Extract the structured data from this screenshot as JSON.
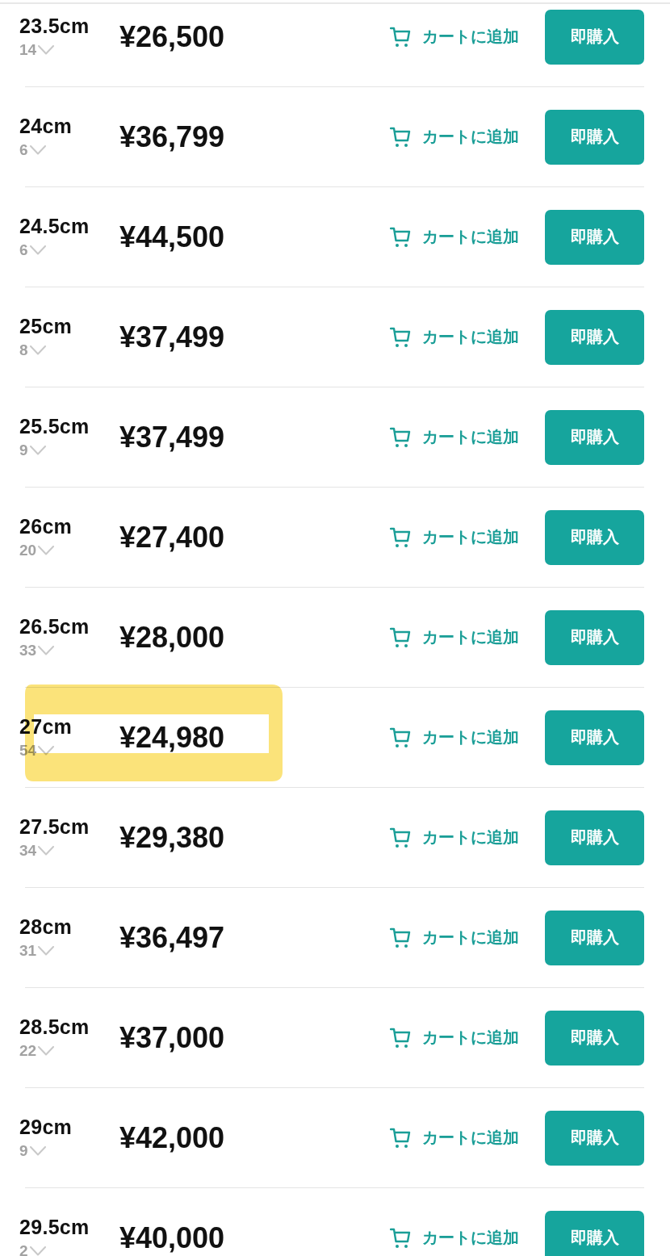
{
  "rows": [
    {
      "size": "23.5cm",
      "count": "14",
      "price": "¥26,500",
      "cart_label": "カートに追加",
      "buy_label": "即購入",
      "highlighted": false
    },
    {
      "size": "24cm",
      "count": "6",
      "price": "¥36,799",
      "cart_label": "カートに追加",
      "buy_label": "即購入",
      "highlighted": false
    },
    {
      "size": "24.5cm",
      "count": "6",
      "price": "¥44,500",
      "cart_label": "カートに追加",
      "buy_label": "即購入",
      "highlighted": false
    },
    {
      "size": "25cm",
      "count": "8",
      "price": "¥37,499",
      "cart_label": "カートに追加",
      "buy_label": "即購入",
      "highlighted": false
    },
    {
      "size": "25.5cm",
      "count": "9",
      "price": "¥37,499",
      "cart_label": "カートに追加",
      "buy_label": "即購入",
      "highlighted": false
    },
    {
      "size": "26cm",
      "count": "20",
      "price": "¥27,400",
      "cart_label": "カートに追加",
      "buy_label": "即購入",
      "highlighted": false
    },
    {
      "size": "26.5cm",
      "count": "33",
      "price": "¥28,000",
      "cart_label": "カートに追加",
      "buy_label": "即購入",
      "highlighted": false
    },
    {
      "size": "27cm",
      "count": "54",
      "price": "¥24,980",
      "cart_label": "カートに追加",
      "buy_label": "即購入",
      "highlighted": true
    },
    {
      "size": "27.5cm",
      "count": "34",
      "price": "¥29,380",
      "cart_label": "カートに追加",
      "buy_label": "即購入",
      "highlighted": false
    },
    {
      "size": "28cm",
      "count": "31",
      "price": "¥36,497",
      "cart_label": "カートに追加",
      "buy_label": "即購入",
      "highlighted": false
    },
    {
      "size": "28.5cm",
      "count": "22",
      "price": "¥37,000",
      "cart_label": "カートに追加",
      "buy_label": "即購入",
      "highlighted": false
    },
    {
      "size": "29cm",
      "count": "9",
      "price": "¥42,000",
      "cart_label": "カートに追加",
      "buy_label": "即購入",
      "highlighted": false
    },
    {
      "size": "29.5cm",
      "count": "2",
      "price": "¥40,000",
      "cart_label": "カートに追加",
      "buy_label": "即購入",
      "highlighted": false
    }
  ]
}
